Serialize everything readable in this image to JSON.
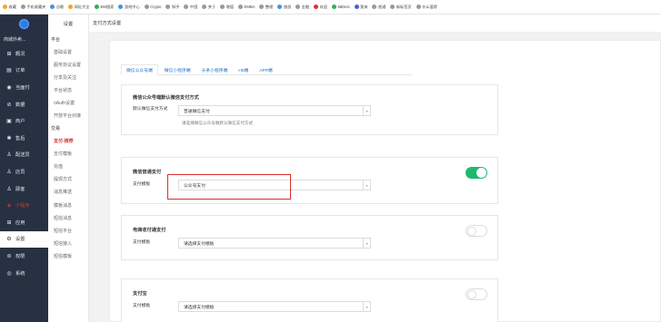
{
  "bookmarks": [
    {
      "label": "收藏",
      "icon": "star-icon",
      "color": "#f5a623"
    },
    {
      "label": "手机收藏夹",
      "icon": "phone-icon",
      "color": "#999999"
    },
    {
      "label": "谷歌",
      "icon": "globe-icon",
      "color": "#4a90e2"
    },
    {
      "label": "网址大全",
      "icon": "bookmark-icon",
      "color": "#f5a623"
    },
    {
      "label": "360搜索",
      "icon": "search-icon",
      "color": "#2bb24c"
    },
    {
      "label": "游戏中心",
      "icon": "game-icon",
      "color": "#4a90e2"
    },
    {
      "label": "Crypto",
      "icon": "globe-icon",
      "color": "#999999"
    },
    {
      "label": "知乎",
      "icon": "globe-icon",
      "color": "#999999"
    },
    {
      "label": "中国",
      "icon": "globe-icon",
      "color": "#999999"
    },
    {
      "label": "关于",
      "icon": "globe-icon",
      "color": "#999999"
    },
    {
      "label": "增值",
      "icon": "globe-icon",
      "color": "#999999"
    },
    {
      "label": "EMBA",
      "icon": "globe-icon",
      "color": "#999999"
    },
    {
      "label": "整理",
      "icon": "globe-icon",
      "color": "#999999"
    },
    {
      "label": "旅游",
      "icon": "globe-icon",
      "color": "#4a90e2"
    },
    {
      "label": "金融",
      "icon": "globe-icon",
      "color": "#999999"
    },
    {
      "label": "欢迎",
      "icon": "globe-icon",
      "color": "#e03030"
    },
    {
      "label": "68Desi",
      "icon": "globe-icon",
      "color": "#2bb24c"
    },
    {
      "label": "我来",
      "icon": "globe-icon",
      "color": "#4a5fd0"
    },
    {
      "label": "普通",
      "icon": "globe-icon",
      "color": "#999999"
    },
    {
      "label": "新标签页",
      "icon": "globe-icon",
      "color": "#999999"
    },
    {
      "label": "什么值得",
      "icon": "globe-icon",
      "color": "#999999"
    }
  ],
  "nav": {
    "top_label": "商城外卖...",
    "items": [
      {
        "label": "概况",
        "icon": "dashboard-icon",
        "glyph": "⊞"
      },
      {
        "label": "订单",
        "icon": "order-icon",
        "glyph": "▤"
      },
      {
        "label": "当面付",
        "icon": "payment-icon",
        "glyph": "◉"
      },
      {
        "label": "数据",
        "icon": "data-icon",
        "glyph": "⊘"
      },
      {
        "label": "商户",
        "icon": "merchant-icon",
        "glyph": "▣"
      },
      {
        "label": "售后",
        "icon": "aftersale-icon",
        "glyph": "✱"
      },
      {
        "label": "配送员",
        "icon": "courier-icon",
        "glyph": "♙"
      },
      {
        "label": "店员",
        "icon": "clerk-icon",
        "glyph": "♙"
      },
      {
        "label": "顾客",
        "icon": "customer-icon",
        "glyph": "♙"
      },
      {
        "label": "小程序",
        "icon": "miniapp-icon",
        "glyph": "◈"
      },
      {
        "label": "应用",
        "icon": "apps-icon",
        "glyph": "⊞"
      },
      {
        "label": "设置",
        "icon": "gear-icon",
        "glyph": "⚙"
      },
      {
        "label": "权限",
        "icon": "lock-icon",
        "glyph": "⊜"
      },
      {
        "label": "系统",
        "icon": "system-icon",
        "glyph": "◎"
      }
    ]
  },
  "sub": {
    "head": "设置",
    "groups": [
      {
        "title": "平台",
        "items": [
          "基础设置",
          "服务协议设置",
          "分享及关注",
          "平台状态",
          "oAuth设置",
          "开放平台对接"
        ]
      },
      {
        "title": "交易",
        "items": [
          "支付-推荐",
          "支付模板",
          "充值",
          "提现方式",
          "消息推送",
          "模板消息",
          "短信消息",
          "短信平台",
          "短信接入",
          "短信模板"
        ]
      }
    ]
  },
  "page": {
    "title": "支付方式设置",
    "tabs": [
      "微信公众号端",
      "微信小程序端",
      "头条小程序端",
      "H5端",
      "APP端"
    ]
  },
  "panels": {
    "default": {
      "title": "微信公众号端默认微信支付方式",
      "label": "默认微信支付方式",
      "value": "普通微信支付",
      "hint": "请选择微信公众号端默认微信支付方式"
    },
    "wechat_pay": {
      "title": "微信普通支付",
      "label": "支付模板",
      "value": "公众号支付",
      "enabled": true
    },
    "ecommerce_pay": {
      "title": "电商收付通支付",
      "label": "支付模板",
      "value": "请选择支付模板",
      "enabled": false
    },
    "alipay": {
      "title": "支付宝",
      "label": "支付模板",
      "value": "请选择支付模板",
      "enabled": false
    }
  },
  "colors": {
    "toggle_on": "#1dba6c",
    "highlight": "#d9302c",
    "nav_bg": "#273142",
    "tab_text": "#1f6fd0"
  }
}
